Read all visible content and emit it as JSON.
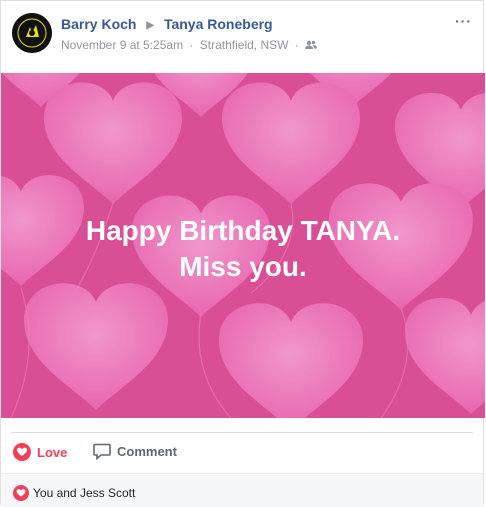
{
  "post": {
    "author": "Barry Koch",
    "target": "Tanya Roneberg",
    "arrow_icon": "triangle-right-icon",
    "timestamp": "November 9 at 5:25am",
    "location": "Strathfield, NSW",
    "separator": "·",
    "privacy_icon": "friends-icon",
    "more_label": "···",
    "avatar_text": "MIDNIGHT OIL"
  },
  "hero": {
    "line1": "Happy Birthday TANYA.",
    "line2": "Miss you.",
    "background": "#d94f95",
    "heart_color": "#ef7fbf"
  },
  "actions": {
    "love_label": "Love",
    "comment_label": "Comment",
    "love_color": "#f33e58"
  },
  "reactions": {
    "summary": "You and Jess Scott"
  }
}
